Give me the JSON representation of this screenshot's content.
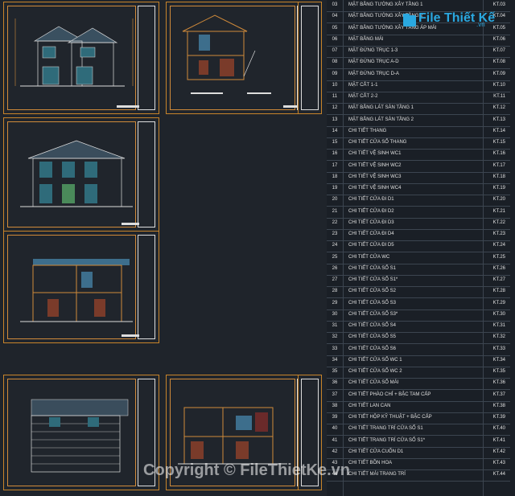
{
  "brand": {
    "name": "File Thiết Kế",
    "suffix": ".vn"
  },
  "watermark": "Copyright © FileThietKe.vn",
  "drawing_list": [
    {
      "no": "03",
      "name": "MẶT BẰNG TƯỜNG XÂY TẦNG 1",
      "code": "KT.03"
    },
    {
      "no": "04",
      "name": "MẶT BẰNG TƯỜNG XÂY TẦNG 2",
      "code": "KT.04"
    },
    {
      "no": "05",
      "name": "MẶT BẰNG TƯỜNG XÂY TẦNG ÁP MÁI",
      "code": "KT.05"
    },
    {
      "no": "06",
      "name": "MẶT BẰNG MÁI",
      "code": "KT.06"
    },
    {
      "no": "07",
      "name": "MẶT ĐỨNG TRỤC 1-3",
      "code": "KT.07"
    },
    {
      "no": "08",
      "name": "MẶT ĐỨNG TRỤC A-D",
      "code": "KT.08"
    },
    {
      "no": "09",
      "name": "MẶT ĐỨNG TRỤC D-A",
      "code": "KT.09"
    },
    {
      "no": "10",
      "name": "MẶT CẮT 1-1",
      "code": "KT.10"
    },
    {
      "no": "11",
      "name": "MẶT CẮT 2-2",
      "code": "KT.11"
    },
    {
      "no": "12",
      "name": "MẶT BẰNG LÁT SÀN TẦNG 1",
      "code": "KT.12"
    },
    {
      "no": "13",
      "name": "MẶT BẰNG LÁT SÀN TẦNG 2",
      "code": "KT.13"
    },
    {
      "no": "14",
      "name": "CHI TIẾT THANG",
      "code": "KT.14"
    },
    {
      "no": "15",
      "name": "CHI TIẾT CỬA SỔ THANG",
      "code": "KT.15"
    },
    {
      "no": "16",
      "name": "CHI TIẾT VỆ SINH WC1",
      "code": "KT.16"
    },
    {
      "no": "17",
      "name": "CHI TIẾT VỆ SINH WC2",
      "code": "KT.17"
    },
    {
      "no": "18",
      "name": "CHI TIẾT VỆ SINH WC3",
      "code": "KT.18"
    },
    {
      "no": "19",
      "name": "CHI TIẾT VỆ SINH WC4",
      "code": "KT.19"
    },
    {
      "no": "20",
      "name": "CHI TIẾT CỬA ĐI D1",
      "code": "KT.20"
    },
    {
      "no": "21",
      "name": "CHI TIẾT CỬA ĐI D2",
      "code": "KT.21"
    },
    {
      "no": "22",
      "name": "CHI TIẾT CỬA ĐI D3",
      "code": "KT.22"
    },
    {
      "no": "23",
      "name": "CHI TIẾT CỬA ĐI D4",
      "code": "KT.23"
    },
    {
      "no": "24",
      "name": "CHI TIẾT CỬA ĐI D5",
      "code": "KT.24"
    },
    {
      "no": "25",
      "name": "CHI TIẾT CỬA WC",
      "code": "KT.25"
    },
    {
      "no": "26",
      "name": "CHI TIẾT CỬA SỔ S1",
      "code": "KT.26"
    },
    {
      "no": "27",
      "name": "CHI TIẾT CỬA SỔ S1*",
      "code": "KT.27"
    },
    {
      "no": "28",
      "name": "CHI TIẾT CỬA SỔ S2",
      "code": "KT.28"
    },
    {
      "no": "29",
      "name": "CHI TIẾT CỬA SỔ S3",
      "code": "KT.29"
    },
    {
      "no": "30",
      "name": "CHI TIẾT CỬA SỔ S3*",
      "code": "KT.30"
    },
    {
      "no": "31",
      "name": "CHI TIẾT CỬA SỔ S4",
      "code": "KT.31"
    },
    {
      "no": "32",
      "name": "CHI TIẾT CỬA SỔ S5",
      "code": "KT.32"
    },
    {
      "no": "33",
      "name": "CHI TIẾT CỬA SỔ S6",
      "code": "KT.33"
    },
    {
      "no": "34",
      "name": "CHI TIẾT CỬA SỔ WC 1",
      "code": "KT.34"
    },
    {
      "no": "35",
      "name": "CHI TIẾT CỬA SỔ WC 2",
      "code": "KT.35"
    },
    {
      "no": "36",
      "name": "CHI TIẾT CỬA SỔ MÁI",
      "code": "KT.36"
    },
    {
      "no": "37",
      "name": "CHI TIẾT PHÀO CHỈ + BẬC TAM CẤP",
      "code": "KT.37"
    },
    {
      "no": "38",
      "name": "CHI TIẾT LAN CAN",
      "code": "KT.38"
    },
    {
      "no": "39",
      "name": "CHI TIẾT HỘP KỸ THUẬT + BẬC CẤP",
      "code": "KT.39"
    },
    {
      "no": "40",
      "name": "CHI TIẾT TRANG TRÍ CỬA SỔ S1",
      "code": "KT.40"
    },
    {
      "no": "41",
      "name": "CHI TIẾT TRANG TRÍ CỬA SỔ S1*",
      "code": "KT.41"
    },
    {
      "no": "42",
      "name": "CHI TIẾT CỬA CUỐN D1",
      "code": "KT.42"
    },
    {
      "no": "43",
      "name": "CHI TIẾT BỒN HOA",
      "code": "KT.43"
    },
    {
      "no": "44",
      "name": "CHI TIẾT MÁI TRANG TRÍ",
      "code": "KT.44"
    }
  ]
}
